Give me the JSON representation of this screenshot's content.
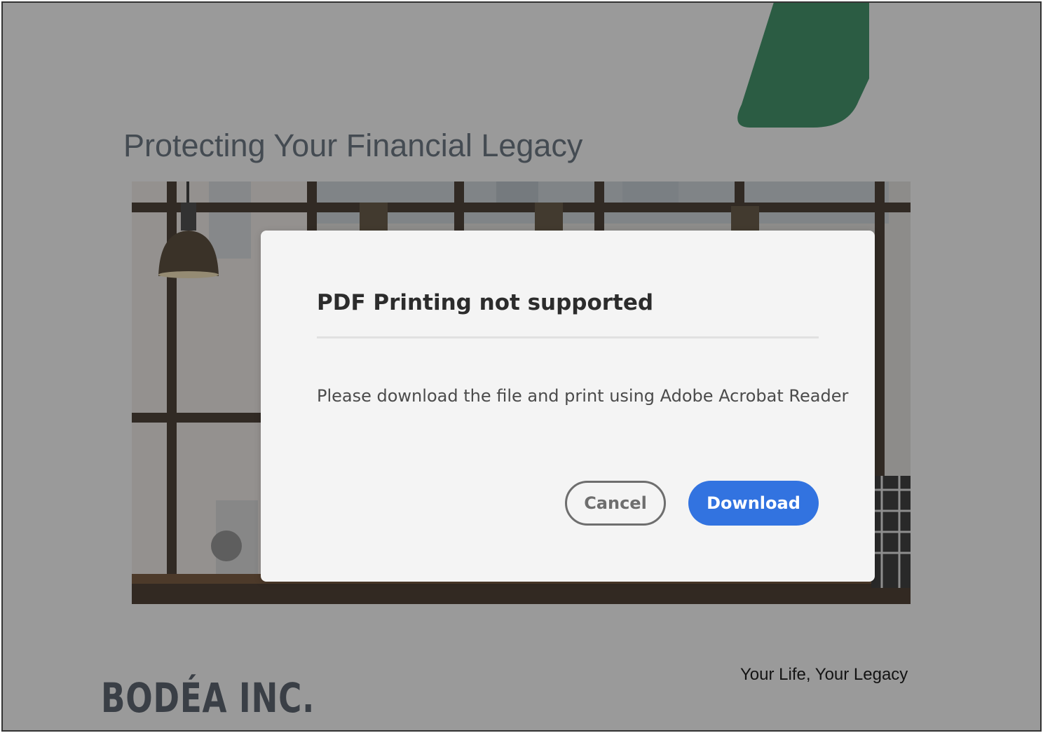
{
  "slide": {
    "title": "Protecting Your Financial Legacy",
    "tagline": "Your Life, Your Legacy",
    "logo_text": "BODÉA INC.",
    "accent_color": "#2e8a5c"
  },
  "dialog": {
    "title": "PDF Printing not supported",
    "message": "Please download the file and print using Adobe Acrobat Reader",
    "cancel_label": "Cancel",
    "download_label": "Download",
    "primary_color": "#3273e0"
  }
}
